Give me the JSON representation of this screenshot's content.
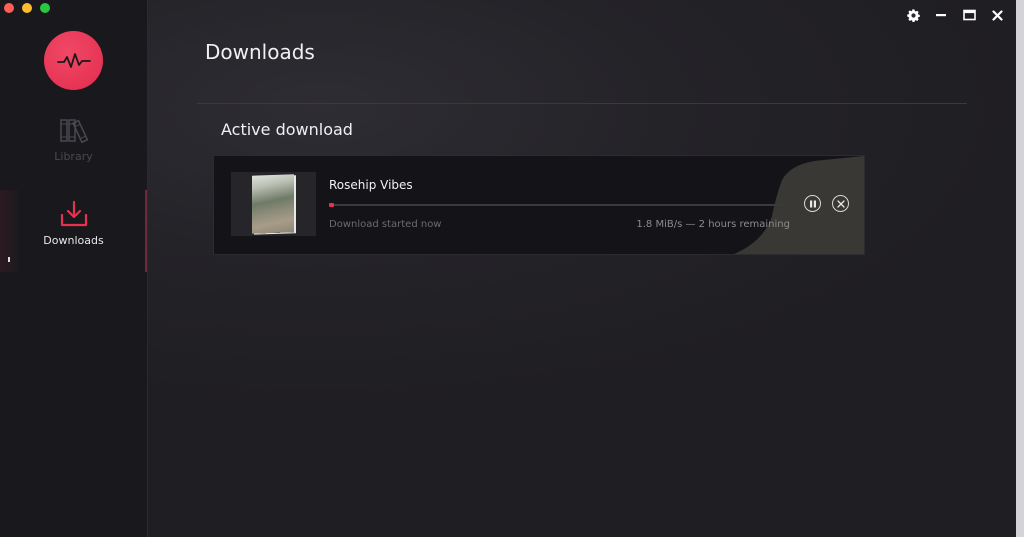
{
  "window": {
    "traffic_lights": [
      "close",
      "minimize",
      "maximize"
    ],
    "controls": [
      {
        "name": "settings",
        "icon": "gear-icon"
      },
      {
        "name": "minimize",
        "icon": "minimize-icon"
      },
      {
        "name": "maximize",
        "icon": "maximize-icon"
      },
      {
        "name": "close",
        "icon": "close-icon"
      }
    ]
  },
  "brand": {
    "icon": "pulse-icon",
    "color": "#e8314f"
  },
  "sidebar": {
    "items": [
      {
        "label": "Library",
        "icon": "books-icon",
        "active": false
      },
      {
        "label": "Downloads",
        "icon": "download-icon",
        "active": true
      }
    ]
  },
  "main": {
    "title": "Downloads",
    "section_title": "Active download",
    "active_download": {
      "title": "Rosehip Vibes",
      "status": "Download started now",
      "speed_eta": "1.8 MiB/s — 2 hours remaining",
      "progress_percent": 1,
      "actions": [
        "pause",
        "cancel"
      ]
    }
  },
  "colors": {
    "accent": "#e8314f",
    "background": "#1f1e22",
    "sidebar": "#19181c"
  }
}
